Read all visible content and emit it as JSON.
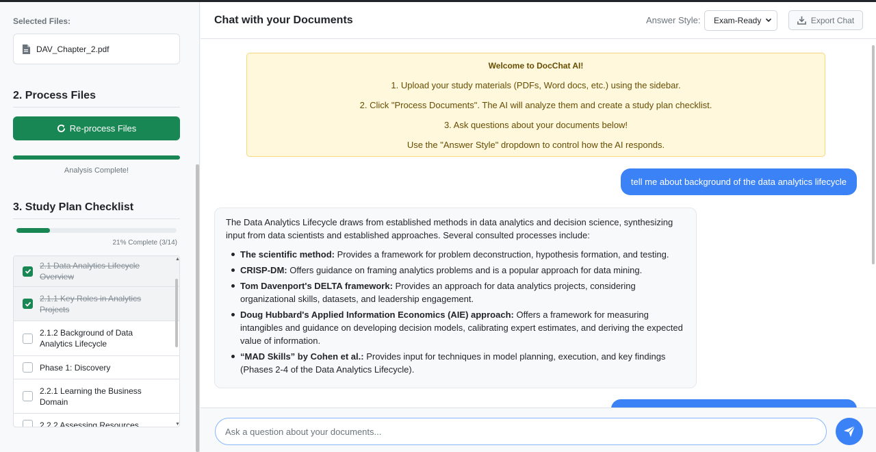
{
  "sidebar": {
    "selected_files_label": "Selected Files:",
    "files": [
      {
        "name": "DAV_Chapter_2.pdf",
        "icon": "pdf-file-icon"
      }
    ],
    "process_section_title": "2. Process Files",
    "reprocess_button_label": "Re-process Files",
    "analysis_progress": 1.0,
    "analysis_status": "Analysis Complete!",
    "study_plan_title": "3. Study Plan Checklist",
    "study_plan_progress": 0.21,
    "study_plan_progress_text": "21% Complete (3/14)",
    "checklist": [
      {
        "label": "2.1 Data Analytics Lifecycle Overview",
        "checked": true
      },
      {
        "label": "2.1.1 Key Roles in Analytics Projects",
        "checked": true
      },
      {
        "label": "2.1.2 Background of Data Analytics Lifecycle",
        "checked": false
      },
      {
        "label": "Phase 1: Discovery",
        "checked": false
      },
      {
        "label": "2.2.1 Learning the Business Domain",
        "checked": false
      },
      {
        "label": "2.2.2 Assessing Resources",
        "checked": false
      }
    ]
  },
  "header": {
    "title": "Chat with your Documents",
    "answer_style_label": "Answer Style:",
    "answer_style_value": "Exam-Ready",
    "export_label": "Export Chat"
  },
  "welcome": {
    "title": "Welcome to DocChat AI!",
    "lines": [
      "1. Upload your study materials (PDFs, Word docs, etc.) using the sidebar.",
      "2. Click \"Process Documents\". The AI will analyze them and create a study plan checklist.",
      "3. Ask questions about your documents below!",
      "Use the \"Answer Style\" dropdown to control how the AI responds."
    ]
  },
  "messages": {
    "user_1": "tell me about background of the data analytics lifecycle",
    "bot_1_intro": "The Data Analytics Lifecycle draws from established methods in data analytics and decision science, synthesizing input from data scientists and established approaches. Several consulted processes include:",
    "bot_1_bullets": [
      {
        "bold": "The scientific method:",
        "text": " Provides a framework for problem deconstruction, hypothesis formation, and testing."
      },
      {
        "bold": "CRISP-DM:",
        "text": " Offers guidance on framing analytics problems and is a popular approach for data mining."
      },
      {
        "bold": "Tom Davenport's DELTA framework:",
        "text": " Provides an approach for data analytics projects, considering organizational skills, datasets, and leadership engagement."
      },
      {
        "bold": "Doug Hubbard's Applied Information Economics (AIE) approach:",
        "text": " Offers a framework for measuring intangibles and guidance on developing decision models, calibrating expert estimates, and deriving the expected value of information."
      },
      {
        "bold": "“MAD Skills” by Cohen et al.:",
        "text": " Provides input for techniques in model planning, execution, and key findings (Phases 2-4 of the Data Analytics Lifecycle)."
      }
    ]
  },
  "input": {
    "placeholder": "Ask a question about your documents...",
    "value": ""
  },
  "colors": {
    "accent_green": "#198754",
    "accent_blue": "#3b82f6",
    "welcome_bg": "#fff8dc"
  }
}
